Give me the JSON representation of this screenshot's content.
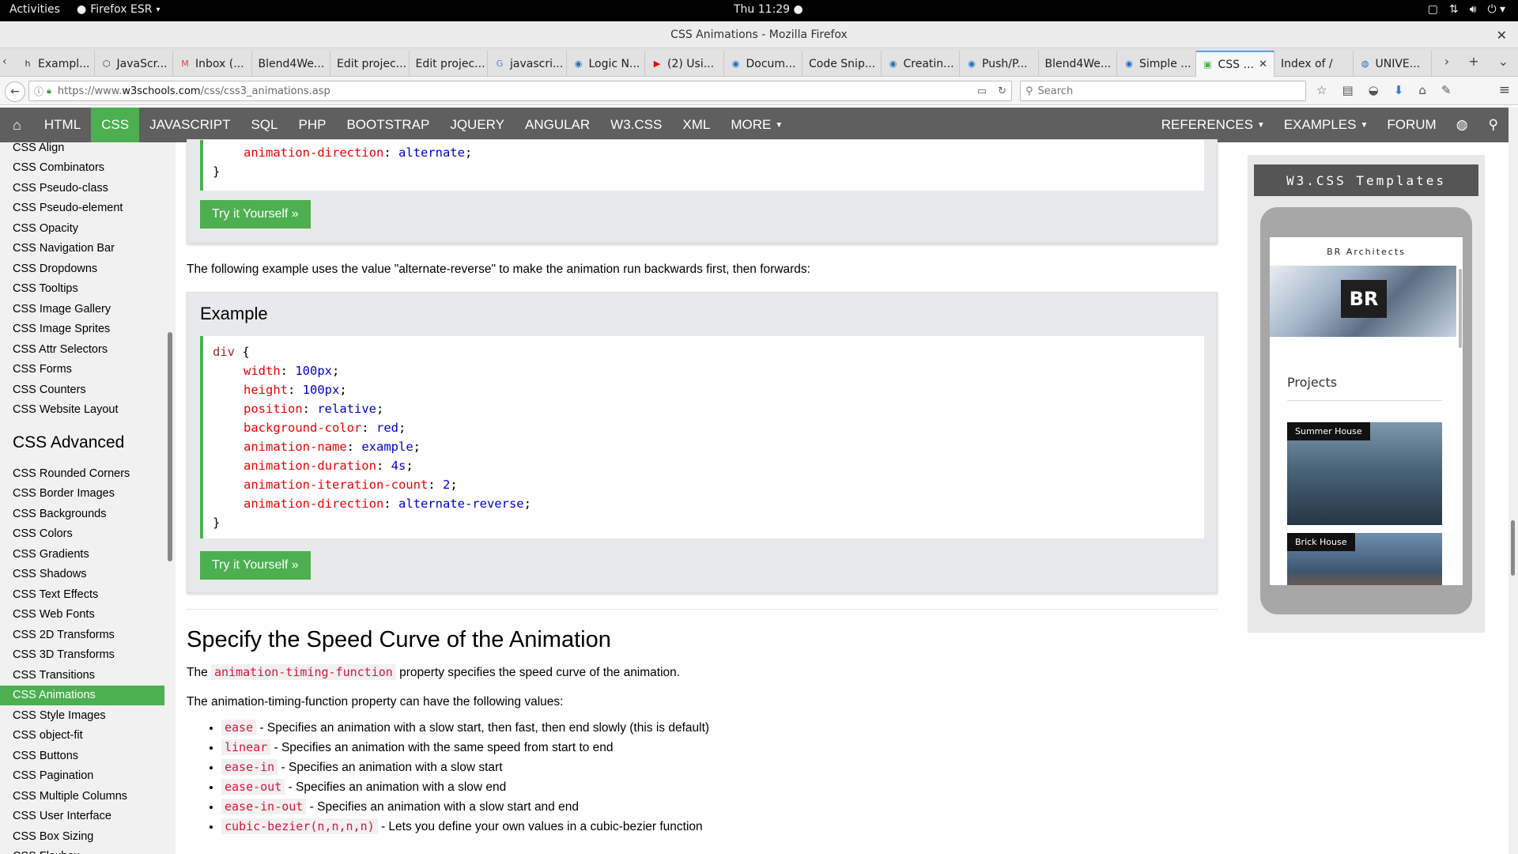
{
  "system_bar": {
    "activities": "Activities",
    "app_name": "Firefox ESR",
    "clock": "Thu 11:29"
  },
  "window": {
    "title": "CSS Animations - Mozilla Firefox"
  },
  "tabs": [
    {
      "label": "Exampl...",
      "icon": "hp-icon"
    },
    {
      "label": "JavaScr...",
      "icon": "codepen-icon"
    },
    {
      "label": "Inbox (...",
      "icon": "gmail-icon"
    },
    {
      "label": "Blend4We..."
    },
    {
      "label": "Edit projec..."
    },
    {
      "label": "Edit projec..."
    },
    {
      "label": "javascri...",
      "icon": "google-icon"
    },
    {
      "label": "Logic N...",
      "icon": "stackexchange-icon"
    },
    {
      "label": "(2) Usi...",
      "icon": "youtube-icon"
    },
    {
      "label": "Docum...",
      "icon": "stackexchange-icon"
    },
    {
      "label": "Code Snip..."
    },
    {
      "label": "Creatin...",
      "icon": "stackexchange-icon"
    },
    {
      "label": "Push/P...",
      "icon": "stackexchange-icon"
    },
    {
      "label": "Blend4We..."
    },
    {
      "label": "Simple ...",
      "icon": "stackexchange-icon"
    },
    {
      "label": "CSS ...",
      "icon": "w3schools-icon",
      "active": true
    },
    {
      "label": "Index of /"
    },
    {
      "label": "UNIVE...",
      "icon": "globe-icon"
    }
  ],
  "navigation": {
    "url_prefix": "https://www.",
    "url_domain": "w3schools.com",
    "url_path": "/css/css3_animations.asp",
    "search_placeholder": "Search"
  },
  "w3_nav": {
    "items": [
      "HTML",
      "CSS",
      "JAVASCRIPT",
      "SQL",
      "PHP",
      "BOOTSTRAP",
      "JQUERY",
      "ANGULAR",
      "W3.CSS",
      "XML",
      "MORE"
    ],
    "active": "CSS",
    "right_items": [
      "REFERENCES",
      "EXAMPLES",
      "FORUM"
    ]
  },
  "sidebar": {
    "links_top": [
      "CSS Align",
      "CSS Combinators",
      "CSS Pseudo-class",
      "CSS Pseudo-element",
      "CSS Opacity",
      "CSS Navigation Bar",
      "CSS Dropdowns",
      "CSS Tooltips",
      "CSS Image Gallery",
      "CSS Image Sprites",
      "CSS Attr Selectors",
      "CSS Forms",
      "CSS Counters",
      "CSS Website Layout"
    ],
    "heading": "CSS Advanced",
    "links_advanced": [
      "CSS Rounded Corners",
      "CSS Border Images",
      "CSS Backgrounds",
      "CSS Colors",
      "CSS Gradients",
      "CSS Shadows",
      "CSS Text Effects",
      "CSS Web Fonts",
      "CSS 2D Transforms",
      "CSS 3D Transforms",
      "CSS Transitions",
      "CSS Animations",
      "CSS Style Images",
      "CSS object-fit",
      "CSS Buttons",
      "CSS Pagination",
      "CSS Multiple Columns",
      "CSS User Interface",
      "CSS Box Sizing",
      "CSS Flexbox"
    ],
    "active": "CSS Animations"
  },
  "main": {
    "example1": {
      "code_line_prop": "animation-direction",
      "code_line_val": "alternate",
      "close_brace": "}",
      "button": "Try it Yourself »"
    },
    "intro_paragraph": "The following example uses the value \"alternate-reverse\" to make the animation run backwards first, then forwards:",
    "example2": {
      "heading": "Example",
      "selector": "div",
      "lines": [
        {
          "prop": "width",
          "val": "100px"
        },
        {
          "prop": "height",
          "val": "100px"
        },
        {
          "prop": "position",
          "val": "relative"
        },
        {
          "prop": "background-color",
          "val": "red"
        },
        {
          "prop": "animation-name",
          "val": "example"
        },
        {
          "prop": "animation-duration",
          "val": "4s"
        },
        {
          "prop": "animation-iteration-count",
          "val": "2"
        },
        {
          "prop": "animation-direction",
          "val": "alternate-reverse"
        }
      ],
      "button": "Try it Yourself »"
    },
    "section_heading": "Specify the Speed Curve of the Animation",
    "timing_para_before": "The ",
    "timing_code": "animation-timing-function",
    "timing_para_after": " property specifies the speed curve of the animation.",
    "values_para": "The animation-timing-function property can have the following values:",
    "values": [
      {
        "code": "ease",
        "text": " - Specifies an animation with a slow start, then fast, then end slowly (this is default)"
      },
      {
        "code": "linear",
        "text": " - Specifies an animation with the same speed from start to end"
      },
      {
        "code": "ease-in",
        "text": " - Specifies an animation with a slow start"
      },
      {
        "code": "ease-out",
        "text": " - Specifies an animation with a slow end"
      },
      {
        "code": "ease-in-out",
        "text": " - Specifies an animation with a slow start and end"
      },
      {
        "code": "cubic-bezier(n,n,n,n)",
        "text": " - Lets you define your own values in a cubic-bezier function"
      }
    ]
  },
  "ad": {
    "label": "W3.CSS Templates",
    "brand": "BR Architects",
    "logo": "BR",
    "projects": "Projects",
    "card1": "Summer House",
    "card2": "Brick House"
  },
  "colors": {
    "accent": "#4caf50",
    "nav_bg": "#5f5f5f",
    "sidebar_bg": "#f1f1f1",
    "code_property": "#ee0000",
    "code_value": "#0000cd",
    "code_selector": "#a52a2a",
    "inline_code": "#dc143c"
  }
}
